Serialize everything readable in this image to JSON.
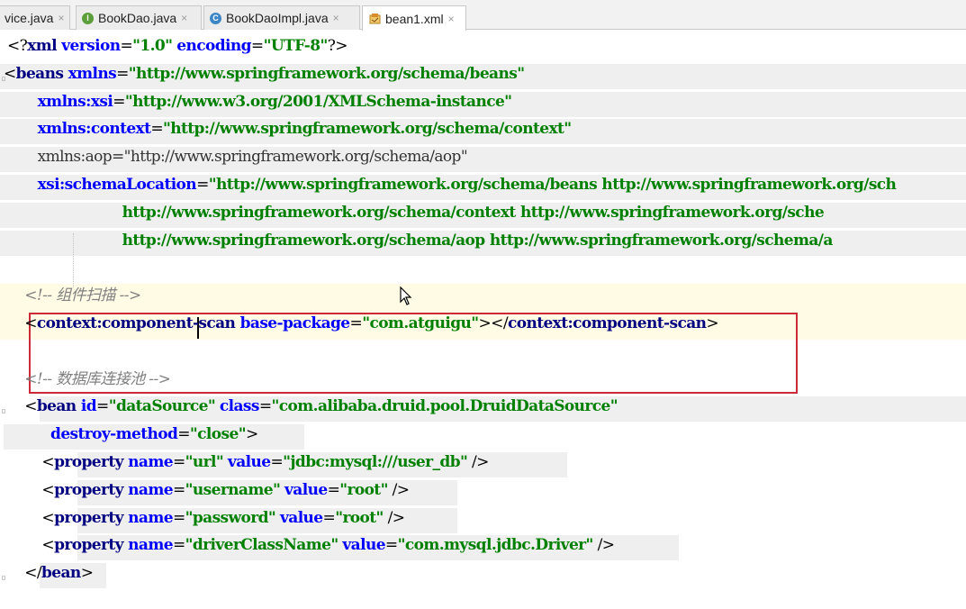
{
  "tabs": [
    {
      "label": "vice.java",
      "icon": "",
      "icon_color": ""
    },
    {
      "label": "BookDao.java",
      "icon": "I",
      "icon_color": "#5b9e3a"
    },
    {
      "label": "BookDaoImpl.java",
      "icon": "C",
      "icon_color": "#3d87c6"
    },
    {
      "label": "bean1.xml",
      "icon": "xml",
      "icon_color": "#d98c2b"
    }
  ],
  "tab_close": "×",
  "lines": [
    [
      {
        "t": "pun",
        "v": "<?"
      },
      {
        "t": "tag",
        "v": "xml "
      },
      {
        "t": "attr",
        "v": "version"
      },
      {
        "t": "pun",
        "v": "="
      },
      {
        "t": "val",
        "v": "\"1.0\""
      },
      {
        "t": "pun",
        "v": " "
      },
      {
        "t": "attr",
        "v": "encoding"
      },
      {
        "t": "pun",
        "v": "="
      },
      {
        "t": "val",
        "v": "\"UTF-8\""
      },
      {
        "t": "pun",
        "v": "?>"
      }
    ],
    [
      {
        "t": "pun",
        "v": "<"
      },
      {
        "t": "tag",
        "v": "beans "
      },
      {
        "t": "attr",
        "v": "xmlns"
      },
      {
        "t": "pun",
        "v": "="
      },
      {
        "t": "val",
        "v": "\"http://www.springframework.org/schema/beans\""
      }
    ],
    [
      {
        "t": "pun",
        "v": "       "
      },
      {
        "t": "attr",
        "v": "xmlns:xsi"
      },
      {
        "t": "pun",
        "v": "="
      },
      {
        "t": "val",
        "v": "\"http://www.w3.org/2001/XMLSchema-instance\""
      }
    ],
    [
      {
        "t": "pun",
        "v": "       "
      },
      {
        "t": "attr",
        "v": "xmlns:context"
      },
      {
        "t": "pun",
        "v": "="
      },
      {
        "t": "val",
        "v": "\"http://www.springframework.org/schema/context\""
      }
    ],
    [
      {
        "t": "pun",
        "v": "       "
      },
      {
        "t": "attrp",
        "v": "xmlns:aop=\"http://www.springframework.org/schema/aop\""
      }
    ],
    [
      {
        "t": "pun",
        "v": "       "
      },
      {
        "t": "attr",
        "v": "xsi:schemaLocation"
      },
      {
        "t": "pun",
        "v": "="
      },
      {
        "t": "val",
        "v": "\"http://www.springframework.org/schema/beans http://www.springframework.org/sch"
      }
    ],
    [
      {
        "t": "val",
        "v": "                        http://www.springframework.org/schema/context http://www.springframework.org/sche"
      }
    ],
    [
      {
        "t": "val",
        "v": "                        http://www.springframework.org/schema/aop http://www.springframework.org/schema/a"
      }
    ],
    [],
    [
      {
        "t": "pun",
        "v": "    "
      },
      {
        "t": "cmt",
        "v": "<!-- 组件扫描 -->"
      }
    ],
    [
      {
        "t": "pun",
        "v": "    <"
      },
      {
        "t": "tag",
        "v": "context:component-scan "
      },
      {
        "t": "attr",
        "v": "base-package"
      },
      {
        "t": "pun",
        "v": "="
      },
      {
        "t": "val",
        "v": "\"com.atguigu\""
      },
      {
        "t": "pun",
        "v": "></"
      },
      {
        "t": "tag",
        "v": "context:component-scan"
      },
      {
        "t": "pun",
        "v": ">"
      }
    ],
    [],
    [
      {
        "t": "pun",
        "v": "    "
      },
      {
        "t": "cmt",
        "v": "<!-- 数据库连接池 -->"
      }
    ],
    [
      {
        "t": "pun",
        "v": "    <"
      },
      {
        "t": "tag",
        "v": "bean "
      },
      {
        "t": "attr",
        "v": "id"
      },
      {
        "t": "pun",
        "v": "="
      },
      {
        "t": "val",
        "v": "\"dataSource\""
      },
      {
        "t": "pun",
        "v": " "
      },
      {
        "t": "attr",
        "v": "class"
      },
      {
        "t": "pun",
        "v": "="
      },
      {
        "t": "val",
        "v": "\"com.alibaba.druid.pool.DruidDataSource\""
      }
    ],
    [
      {
        "t": "pun",
        "v": "          "
      },
      {
        "t": "attr",
        "v": "destroy-method"
      },
      {
        "t": "pun",
        "v": "="
      },
      {
        "t": "val",
        "v": "\"close\""
      },
      {
        "t": "pun",
        "v": ">"
      }
    ],
    [
      {
        "t": "pun",
        "v": "        <"
      },
      {
        "t": "tag",
        "v": "property "
      },
      {
        "t": "attr",
        "v": "name"
      },
      {
        "t": "pun",
        "v": "="
      },
      {
        "t": "val",
        "v": "\"url\""
      },
      {
        "t": "pun",
        "v": " "
      },
      {
        "t": "attr",
        "v": "value"
      },
      {
        "t": "pun",
        "v": "="
      },
      {
        "t": "val",
        "v": "\"jdbc:mysql:///user_db\""
      },
      {
        "t": "pun",
        "v": " />"
      }
    ],
    [
      {
        "t": "pun",
        "v": "        <"
      },
      {
        "t": "tag",
        "v": "property "
      },
      {
        "t": "attr",
        "v": "name"
      },
      {
        "t": "pun",
        "v": "="
      },
      {
        "t": "val",
        "v": "\"username\""
      },
      {
        "t": "pun",
        "v": " "
      },
      {
        "t": "attr",
        "v": "value"
      },
      {
        "t": "pun",
        "v": "="
      },
      {
        "t": "val",
        "v": "\"root\""
      },
      {
        "t": "pun",
        "v": " />"
      }
    ],
    [
      {
        "t": "pun",
        "v": "        <"
      },
      {
        "t": "tag",
        "v": "property "
      },
      {
        "t": "attr",
        "v": "name"
      },
      {
        "t": "pun",
        "v": "="
      },
      {
        "t": "val",
        "v": "\"password\""
      },
      {
        "t": "pun",
        "v": " "
      },
      {
        "t": "attr",
        "v": "value"
      },
      {
        "t": "pun",
        "v": "="
      },
      {
        "t": "val",
        "v": "\"root\""
      },
      {
        "t": "pun",
        "v": " />"
      }
    ],
    [
      {
        "t": "pun",
        "v": "        <"
      },
      {
        "t": "tag",
        "v": "property "
      },
      {
        "t": "attr",
        "v": "name"
      },
      {
        "t": "pun",
        "v": "="
      },
      {
        "t": "val",
        "v": "\"driverClassName\""
      },
      {
        "t": "pun",
        "v": " "
      },
      {
        "t": "attr",
        "v": "value"
      },
      {
        "t": "pun",
        "v": "="
      },
      {
        "t": "val",
        "v": "\"com.mysql.jdbc.Driver\""
      },
      {
        "t": "pun",
        "v": " />"
      }
    ],
    [
      {
        "t": "pun",
        "v": "    </"
      },
      {
        "t": "tag",
        "v": "bean"
      },
      {
        "t": "pun",
        "v": ">"
      }
    ]
  ]
}
